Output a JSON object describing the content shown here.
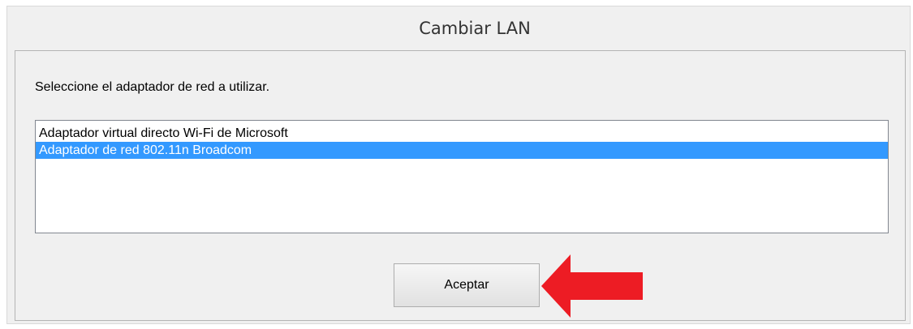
{
  "dialog": {
    "title": "Cambiar LAN",
    "prompt": "Seleccione el adaptador de red a utilizar.",
    "adapters": [
      {
        "label": "Adaptador virtual directo Wi-Fi de Microsoft",
        "selected": false
      },
      {
        "label": "Adaptador de red 802.11n Broadcom",
        "selected": true
      }
    ],
    "ok_label": "Aceptar"
  },
  "annotation": {
    "arrow_icon": "left-arrow-icon",
    "arrow_color": "#ed1c24"
  },
  "colors": {
    "selection": "#3399ff",
    "dialog_bg": "#f0f0f0"
  }
}
